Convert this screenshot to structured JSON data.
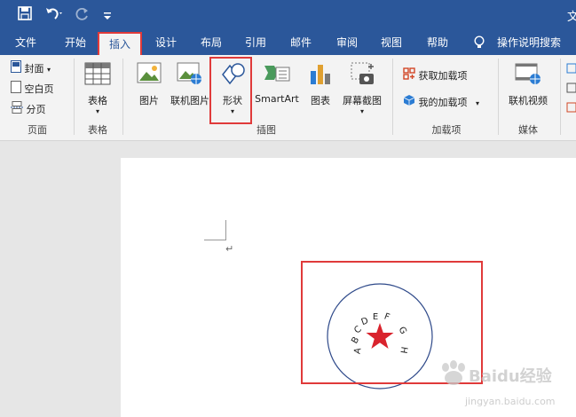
{
  "window": {
    "corner_text": "文"
  },
  "tabs": [
    {
      "label": "文件"
    },
    {
      "label": "开始"
    },
    {
      "label": "插入"
    },
    {
      "label": "设计"
    },
    {
      "label": "布局"
    },
    {
      "label": "引用"
    },
    {
      "label": "邮件"
    },
    {
      "label": "审阅"
    },
    {
      "label": "视图"
    },
    {
      "label": "帮助"
    }
  ],
  "tell_me": "操作说明搜索",
  "ribbon": {
    "pages": {
      "cover": "封面",
      "blank": "空白页",
      "break": "分页",
      "group": "页面"
    },
    "tables": {
      "table": "表格",
      "group": "表格"
    },
    "illustrations": {
      "picture": "图片",
      "online_picture": "联机图片",
      "shapes": "形状",
      "smartart": "SmartArt",
      "chart": "图表",
      "screenshot": "屏幕截图",
      "group": "插图"
    },
    "addins": {
      "get": "获取加载项",
      "my": "我的加载项",
      "group": "加载项"
    },
    "media": {
      "video": "联机视频",
      "group": "媒体"
    }
  },
  "document": {
    "paragraph_mark": "↵",
    "seal_text": [
      "A",
      "B",
      "C",
      "D",
      "E",
      "F",
      "G",
      "H"
    ]
  },
  "watermark": {
    "line1": "Baidu经验",
    "line2": "jingyan.baidu.com"
  },
  "colors": {
    "accent": "#2b579a",
    "highlight": "#e03a3a",
    "star": "#d9232d",
    "circle": "#2f4a8a"
  }
}
